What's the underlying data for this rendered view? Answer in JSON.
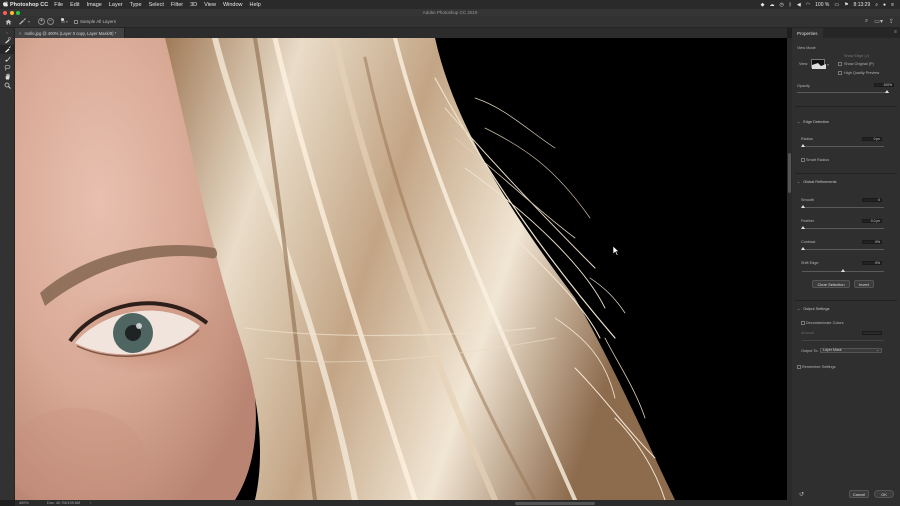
{
  "menubar": {
    "apple": "",
    "app_name": "Photoshop CC",
    "items": [
      "File",
      "Edit",
      "Image",
      "Layer",
      "Type",
      "Select",
      "Filter",
      "3D",
      "View",
      "Window",
      "Help"
    ],
    "battery": "100 %",
    "clock": "8:13:29"
  },
  "window": {
    "title": "Adobe Photoshop CC 2019"
  },
  "options": {
    "add_symbol": "+",
    "subtract_symbol": "−",
    "brush_size": "10",
    "sample_all_layers": "Sample All Layers"
  },
  "document": {
    "tab_label": "mollo.jpg @ 400% (Layer 0 copy, Layer Mask/8) *",
    "zoom": "400%",
    "doc_info": "Doc: 40,7M/109,8M"
  },
  "properties": {
    "tab": "Properties",
    "view_mode_label": "View Mode",
    "view_label": "View:",
    "show_edge": "Show Edge (J)",
    "show_original": "Show Original (P)",
    "high_quality_preview": "High Quality Preview",
    "opacity_label": "Opacity",
    "opacity_value": "100%",
    "edge_detection": "Edge Detection",
    "radius_label": "Radius",
    "radius_value": "0 px",
    "smart_radius": "Smart Radius",
    "global_refinements": "Global Refinements",
    "smooth_label": "Smooth",
    "smooth_value": "0",
    "feather_label": "Feather",
    "feather_value": "0,0 px",
    "contrast_label": "Contrast",
    "contrast_value": "0%",
    "shift_edge_label": "Shift Edge",
    "shift_edge_value": "0%",
    "clear_selection": "Clear Selection",
    "invert": "Invert",
    "output_settings": "Output Settings",
    "decontaminate": "Decontaminate Colors",
    "amount_label": "Amount",
    "output_to_label": "Output To:",
    "output_to_value": "Layer Mask",
    "remember_settings": "Remember Settings",
    "cancel": "Cancel",
    "ok": "OK"
  },
  "colors": {
    "close": "#ff5f57",
    "minimize": "#febc2e",
    "maximize": "#28c840"
  }
}
